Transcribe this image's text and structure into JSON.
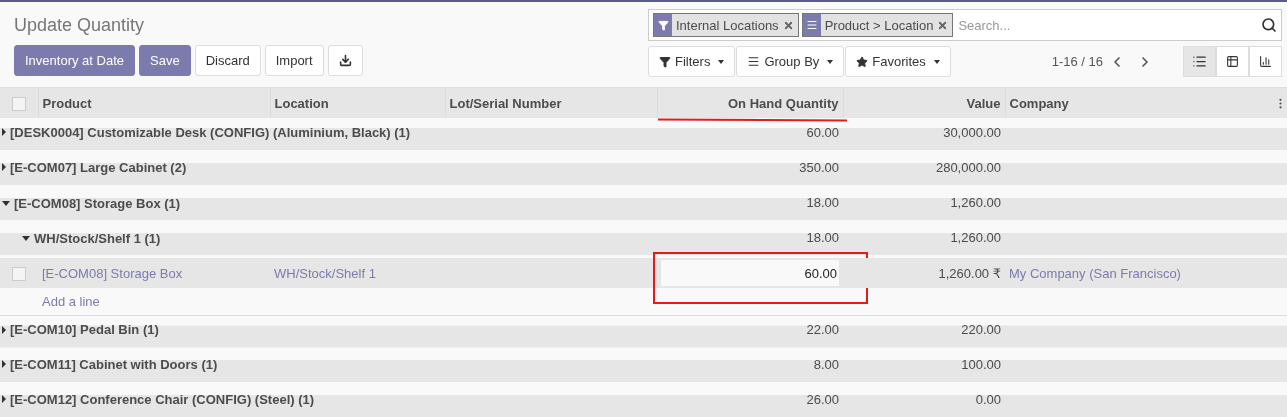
{
  "title": "Update Quantity",
  "buttons": [
    {
      "kind": "primary",
      "label": "Inventory at Date"
    },
    {
      "kind": "primary",
      "label": "Save"
    },
    {
      "kind": "secondary",
      "label": "Discard"
    },
    {
      "kind": "secondary",
      "label": "Import"
    },
    {
      "kind": "download"
    }
  ],
  "search": {
    "facets": [
      {
        "kind": "filter",
        "label": "Internal Locations"
      },
      {
        "kind": "groupby",
        "label": "Product > Location"
      }
    ],
    "placeholder": "Search..."
  },
  "search_options": [
    {
      "kind": "filter",
      "label": "Filters"
    },
    {
      "kind": "groupby",
      "label": "Group By"
    },
    {
      "kind": "favorites",
      "label": "Favorites"
    }
  ],
  "pager": "1-16 / 16",
  "views": [
    {
      "kind": "list",
      "selected": true
    },
    {
      "kind": "pivot",
      "selected": false
    },
    {
      "kind": "graph",
      "selected": false
    }
  ],
  "table": {
    "columns": [
      "Product",
      "Location",
      "Lot/Serial Number",
      "On Hand Quantity",
      "Value",
      "Company"
    ],
    "rows": [
      {
        "kind": "group",
        "label": "[DESK0004] Customizable Desk (CONFIG) (Aluminium, Black) (1)",
        "expanded": false,
        "quantity": "60.00",
        "value": "30,000.00"
      },
      {
        "kind": "group",
        "label": "[E-COM07] Large Cabinet (2)",
        "expanded": false,
        "quantity": "350.00",
        "value": "280,000.00"
      },
      {
        "kind": "group",
        "label": "[E-COM08] Storage Box (1)",
        "expanded": true,
        "quantity": "18.00",
        "value": "1,260.00",
        "children": [
          {
            "kind": "group",
            "label": "WH/Stock/Shelf 1 (1)",
            "expanded": true,
            "quantity": "18.00",
            "value": "1,260.00",
            "children": [
              {
                "kind": "record",
                "checked": false,
                "editing": true,
                "product": "[E-COM08] Storage Box",
                "location": "WH/Stock/Shelf 1",
                "quantity": "60.00",
                "value": "1,260.00 ₹",
                "company": "My Company (San Francisco)"
              },
              {
                "kind": "add_line",
                "label": "Add a line"
              }
            ]
          }
        ]
      },
      {
        "kind": "group",
        "label": "[E-COM10] Pedal Bin (1)",
        "expanded": false,
        "quantity": "22.00",
        "value": "220.00"
      },
      {
        "kind": "group",
        "label": "[E-COM11] Cabinet with Doors (1)",
        "expanded": false,
        "quantity": "8.00",
        "value": "100.00"
      },
      {
        "kind": "group",
        "label": "[E-COM12] Conference Chair (CONFIG) (Steel) (1)",
        "expanded": false,
        "quantity": "26.00",
        "value": "0.00"
      }
    ]
  },
  "select_all_checked": false,
  "annotations": {
    "header_underline": true,
    "cell_frame": true
  }
}
